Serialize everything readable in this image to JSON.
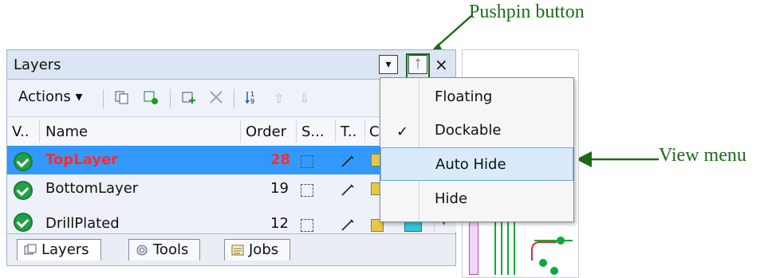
{
  "annotations": {
    "pushpin_label": "Pushpin button",
    "view_menu_label": "View menu"
  },
  "panel": {
    "title": "Layers",
    "toolbar": {
      "actions_label": "Actions"
    },
    "columns": [
      "V..",
      "Name",
      "Order",
      "S...",
      "T..",
      "C"
    ],
    "rows": [
      {
        "name": "TopLayer",
        "order": "28",
        "selected": true
      },
      {
        "name": "BottomLayer",
        "order": "19",
        "selected": false
      },
      {
        "name": "DrillPlated",
        "order": "12",
        "selected": false
      }
    ],
    "tabs": [
      "Layers",
      "Tools",
      "Jobs"
    ]
  },
  "menu": {
    "items": [
      {
        "label": "Floating",
        "checked": false,
        "highlighted": false
      },
      {
        "label": "Dockable",
        "checked": true,
        "highlighted": false
      },
      {
        "label": "Auto Hide",
        "checked": false,
        "highlighted": true
      },
      {
        "label": "Hide",
        "checked": false,
        "highlighted": false
      }
    ]
  },
  "colors": {
    "callout": "#1d6a19",
    "selection": "#3399ff",
    "selected_text": "#ff2b2b"
  },
  "icons": [
    "dropdown-icon",
    "pushpin-icon",
    "close-icon",
    "check-circle-icon",
    "dashed-box-icon",
    "pencil-icon",
    "layer-color-icon",
    "scroll-icon"
  ]
}
